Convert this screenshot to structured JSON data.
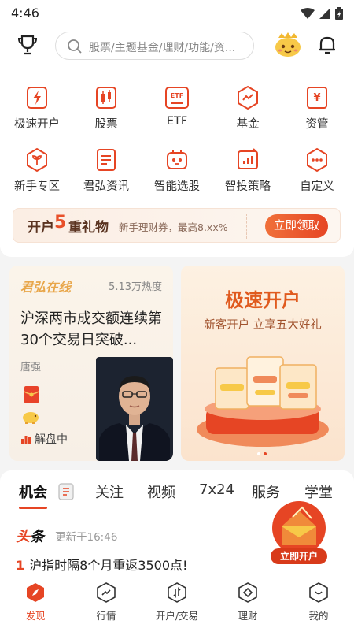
{
  "status_bar": {
    "time": "4:46"
  },
  "header": {
    "search_placeholder": "股票/主题基金/理财/功能/资..."
  },
  "grid": [
    {
      "label": "极速开户",
      "icon": "lightning-icon"
    },
    {
      "label": "股票",
      "icon": "stock-icon"
    },
    {
      "label": "ETF",
      "icon": "etf-icon"
    },
    {
      "label": "基金",
      "icon": "fund-icon"
    },
    {
      "label": "资管",
      "icon": "asset-mgmt-icon"
    },
    {
      "label": "新手专区",
      "icon": "newbie-icon"
    },
    {
      "label": "君弘资讯",
      "icon": "news-icon"
    },
    {
      "label": "智能选股",
      "icon": "robot-icon"
    },
    {
      "label": "智投策略",
      "icon": "strategy-icon"
    },
    {
      "label": "自定义",
      "icon": "more-icon"
    }
  ],
  "promo": {
    "prefix": "开户",
    "number": "5",
    "suffix": "重礼物",
    "desc": "新手理财券，最高8.xx%",
    "button": "立即领取"
  },
  "card_left": {
    "brand": "君弘在线",
    "heat": "5.13万热度",
    "headline": "沪深两市成交额连续第30个交易日突破...",
    "author": "唐强",
    "status": "解盘中"
  },
  "card_right": {
    "title": "极速开户",
    "subtitle": "新客开户 立享五大好礼"
  },
  "tabs": [
    "机会",
    "关注",
    "视频",
    "7x24",
    "服务",
    "学堂"
  ],
  "news": {
    "brand_a": "头",
    "brand_b": "条",
    "updated": "更新于16:46",
    "item_num": "1",
    "item_text": "沪指时隔8个月重返3500点!"
  },
  "float_ad": {
    "button": "立即开户"
  },
  "bottom_nav": [
    {
      "label": "发现",
      "active": true
    },
    {
      "label": "行情",
      "active": false
    },
    {
      "label": "开户/交易",
      "active": false
    },
    {
      "label": "理财",
      "active": false
    },
    {
      "label": "我的",
      "active": false
    }
  ],
  "colors": {
    "accent": "#e64524",
    "gold": "#e8a64a"
  }
}
